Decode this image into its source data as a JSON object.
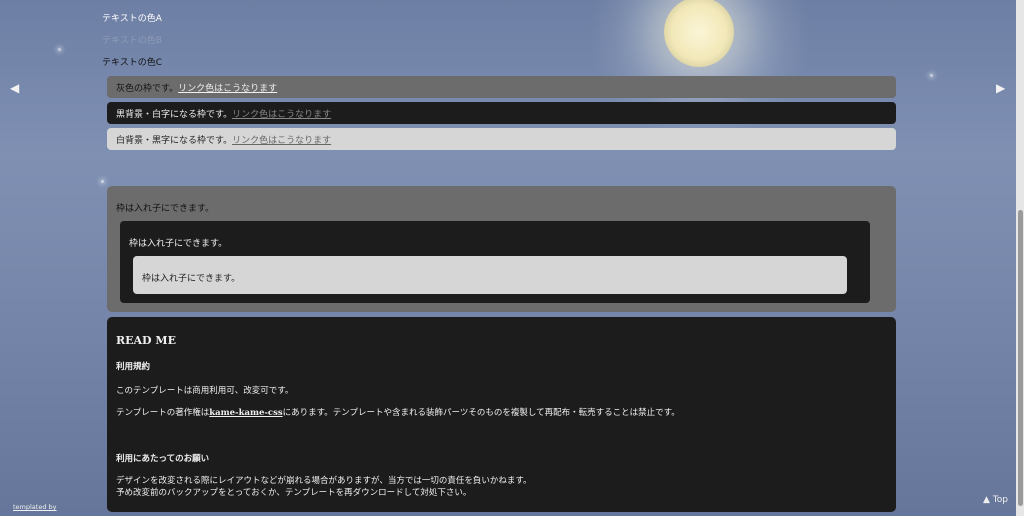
{
  "text_colors": {
    "a": "テキストの色A",
    "b": "テキストの色B",
    "c": "テキストの色C"
  },
  "boxes": {
    "gray_text": "灰色の枠です。",
    "black_text": "黒背景・白字になる枠です。",
    "white_text": "白背景・黒字になる枠です。",
    "link_text": "リンク色はこうなります"
  },
  "nested": {
    "outer": "枠は入れ子にできます。",
    "mid": "枠は入れ子にできます。",
    "inner": "枠は入れ子にできます。"
  },
  "readme": {
    "title": "READ ME",
    "terms_heading": "利用規約",
    "terms_p1": "このテンプレートは商用利用可、改変可です。",
    "terms_p2_prefix": "テンプレートの著作権は",
    "terms_p2_link": "kame-kame-css",
    "terms_p2_suffix": "にあります。テンプレートや含まれる装飾パーツそのものを複製して再配布・転売することは禁止です。",
    "request_heading": "利用にあたってのお願い",
    "request_line1": "デザインを改変される際にレイアウトなどが崩れる場合がありますが、当方では一切の責任を負いかねます。",
    "request_line2": "予め改変前のバックアップをとっておくか、テンプレートを再ダウンロードして対処下さい。"
  },
  "footer": {
    "credit": "templated by",
    "top_label": "▲ Top"
  },
  "nav": {
    "prev": "◀",
    "next": "▶"
  },
  "colors": {
    "gray_box": "#6c6c6c",
    "black_box": "#1c1c1c",
    "white_box": "#d6d6d6"
  }
}
